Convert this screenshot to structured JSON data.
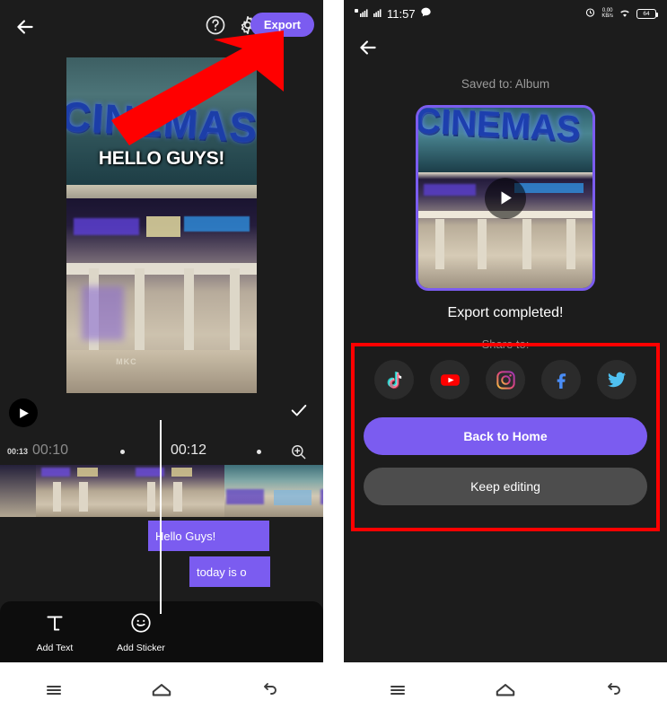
{
  "left_screen": {
    "topbar": {
      "back_icon": "back-arrow-icon",
      "help_icon": "help-circle-icon",
      "settings_icon": "gear-icon",
      "export_label": "Export"
    },
    "preview": {
      "sign_text": "CINEMAS",
      "overlay_text": "HELLO GUYS!",
      "store_text": "MKC"
    },
    "controls": {
      "play_icon": "play-icon",
      "confirm_icon": "check-icon"
    },
    "ruler": {
      "total_duration": "00:13",
      "tick_left": "00:10",
      "tick_right": "00:12",
      "zoom_icon": "zoom-in-icon"
    },
    "text_clips": [
      {
        "label": "Hello Guys!"
      },
      {
        "label": "today is o"
      }
    ],
    "tools": [
      {
        "label": "Add Text",
        "icon": "text-tool-icon"
      },
      {
        "label": "Add Sticker",
        "icon": "sticker-smiley-icon"
      }
    ],
    "navbar": [
      {
        "icon": "menu-recents-icon"
      },
      {
        "icon": "home-icon"
      },
      {
        "icon": "back-nav-icon"
      }
    ]
  },
  "right_screen": {
    "statusbar": {
      "time": "11:57",
      "signal_icon": "signal-bars-icon",
      "message_icon": "message-bubble-icon",
      "alarm_icon": "alarm-clock-icon",
      "net_speed_value": "0.00",
      "net_speed_unit": "KB/s",
      "wifi_icon": "wifi-icon",
      "battery_level": "64"
    },
    "topbar": {
      "back_icon": "back-arrow-icon"
    },
    "saved_to": "Saved to: Album",
    "thumbnail": {
      "sign_text": "CINEMAS",
      "play_icon": "play-icon",
      "border_color": "#7b5cf0"
    },
    "export_status": "Export completed!",
    "share_label": "Share to:",
    "social": [
      {
        "name": "tiktok-icon",
        "label": "TikTok"
      },
      {
        "name": "youtube-icon",
        "label": "YouTube"
      },
      {
        "name": "instagram-icon",
        "label": "Instagram"
      },
      {
        "name": "facebook-icon",
        "label": "Facebook"
      },
      {
        "name": "twitter-icon",
        "label": "Twitter"
      }
    ],
    "primary_button": "Back to Home",
    "secondary_button": "Keep editing",
    "navbar": [
      {
        "icon": "menu-recents-icon"
      },
      {
        "icon": "home-icon"
      },
      {
        "icon": "back-nav-icon"
      }
    ]
  },
  "annotations": {
    "arrow_color": "#ff0000",
    "box_color": "#ff0000"
  }
}
